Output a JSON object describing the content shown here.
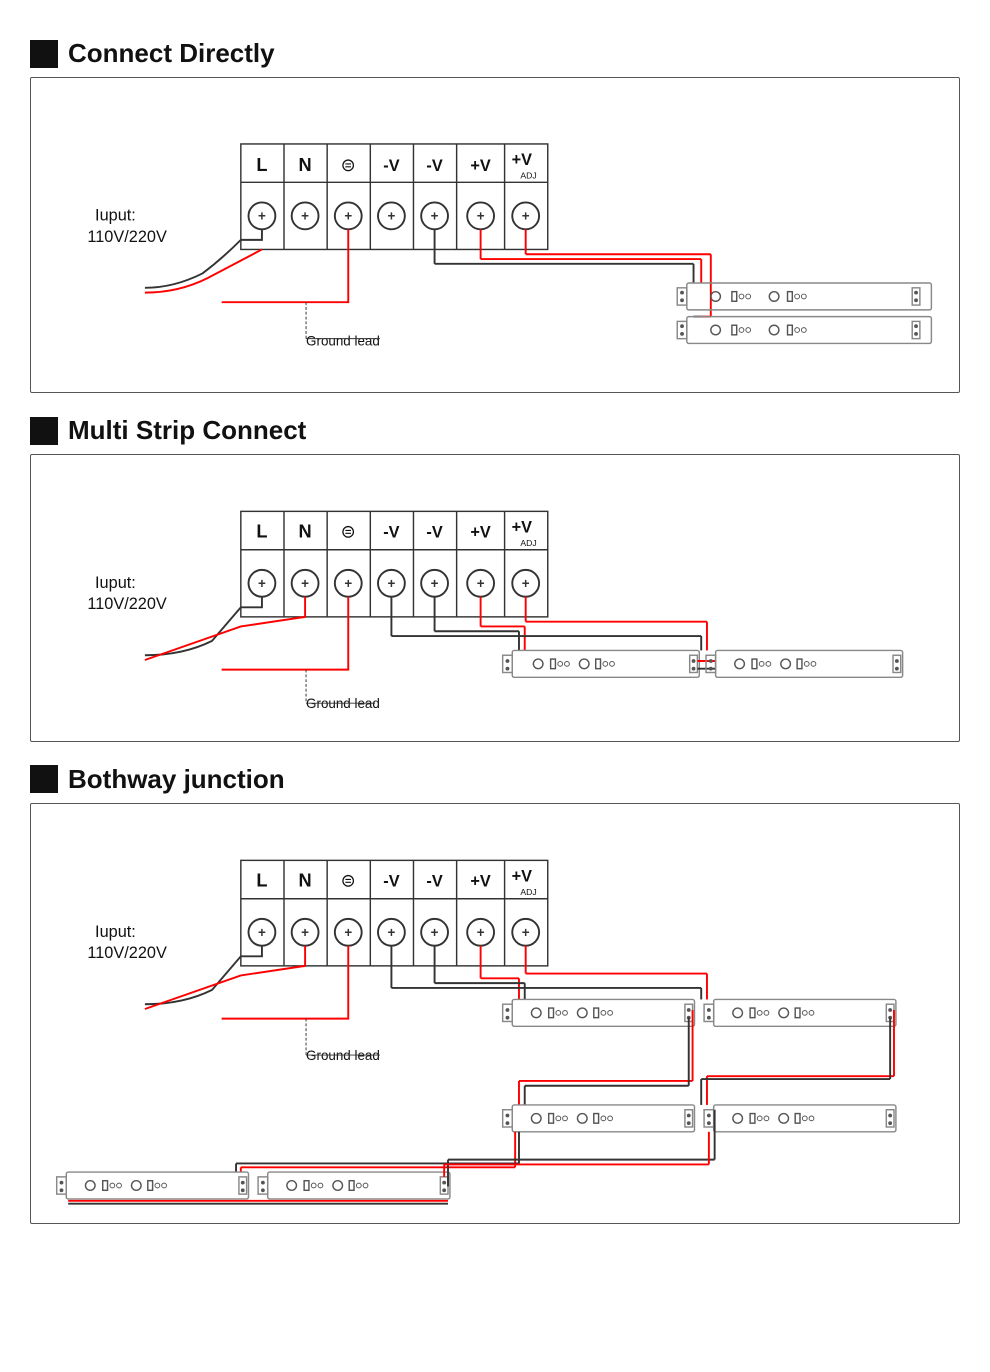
{
  "sections": [
    {
      "id": "connect-directly",
      "title": "Connect Directly",
      "ground_lead": "Ground lead",
      "input_label": "Iuput:\n110V/220V",
      "terminals": [
        "L",
        "N",
        "⊜",
        "-V",
        "-V",
        "+V",
        "+V+V"
      ],
      "terminal_sub": [
        "",
        "",
        "",
        "",
        "",
        "",
        "ADJ"
      ]
    },
    {
      "id": "multi-strip",
      "title": "Multi Strip Connect",
      "ground_lead": "Ground lead",
      "input_label": "Iuput:\n110V/220V"
    },
    {
      "id": "bothway-junction",
      "title": "Bothway junction",
      "ground_lead": "Ground lead",
      "input_label": "Iuput:\n110V/220V"
    }
  ]
}
